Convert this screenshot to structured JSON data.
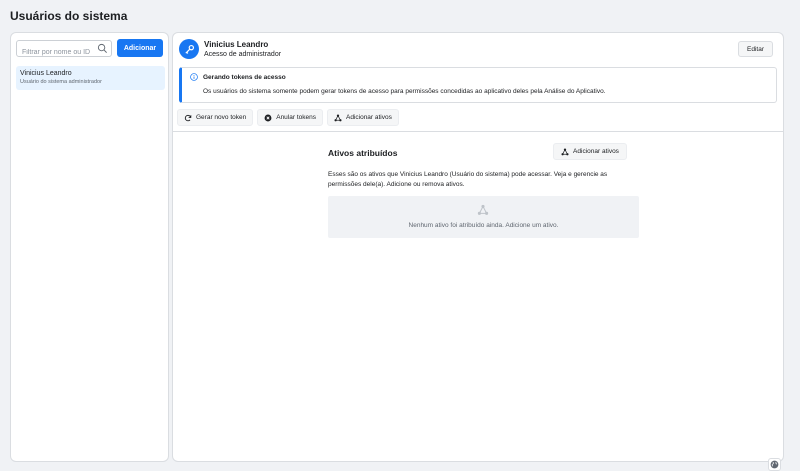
{
  "page": {
    "title": "Usuários do sistema"
  },
  "sidebar": {
    "search_placeholder": "Filtrar por nome ou ID",
    "add_label": "Adicionar",
    "users": [
      {
        "name": "Vinicius Leandro",
        "role": "Usuário do sistema administrador"
      }
    ]
  },
  "detail": {
    "name": "Vinicius Leandro",
    "role": "Acesso de administrador",
    "edit_label": "Editar",
    "info": {
      "title": "Gerando tokens de acesso",
      "body": "Os usuários do sistema somente podem gerar tokens de acesso para permissões concedidas ao aplicativo deles pela Análise do Aplicativo."
    },
    "actions": {
      "generate": "Gerar novo token",
      "revoke": "Anular tokens",
      "add_assets": "Adicionar ativos"
    },
    "assets": {
      "title": "Ativos atribuídos",
      "add_label": "Adicionar ativos",
      "description": "Esses são os ativos que Vinicius Leandro (Usuário do sistema) pode acessar. Veja e gerencie as permissões dele(a). Adicione ou remova ativos.",
      "empty_text": "Nenhum ativo foi atribuído ainda. Adicione um ativo."
    }
  },
  "colors": {
    "primary": "#1877f2",
    "background": "#f0f2f5",
    "selected": "#e7f3ff"
  },
  "icons": [
    "search-icon",
    "key-icon",
    "info-icon",
    "refresh-icon",
    "close-circle-icon",
    "network-icon",
    "globe-icon"
  ]
}
